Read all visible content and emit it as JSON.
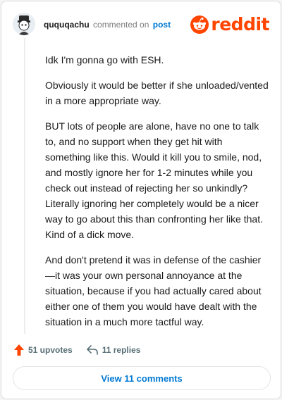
{
  "header": {
    "username": "ququqachu",
    "action_text": "commented on",
    "post_link": "post",
    "logo_text": "reddit"
  },
  "comment": {
    "paragraphs": [
      "Idk I'm gonna go with ESH.",
      "Obviously it would be better if she unloaded/vented in a more appropriate way.",
      "BUT lots of people are alone, have no one to talk to, and no support when they get hit with something like this. Would it kill you to smile, nod, and mostly ignore her for 1-2 minutes while you check out instead of rejecting her so unkindly? Literally ignoring her completely would be a nicer way to go about this than confronting her like that. Kind of a dick move.",
      "And don't pretend it was in defense of the cashier—it was your own personal annoyance at the situation, because if you had actually cared about either one of them you would have dealt with the situation in a much more tactful way."
    ]
  },
  "actions": {
    "upvotes_label": "51 upvotes",
    "replies_label": "11 replies"
  },
  "footer": {
    "view_comments_label": "View 11 comments"
  },
  "colors": {
    "brand": "#ff4500",
    "link": "#0079d3",
    "muted": "#576f76"
  },
  "icons": [
    "avatar-icon",
    "reddit-snoo-icon",
    "upvote-arrow-icon",
    "reply-arrow-icon"
  ]
}
